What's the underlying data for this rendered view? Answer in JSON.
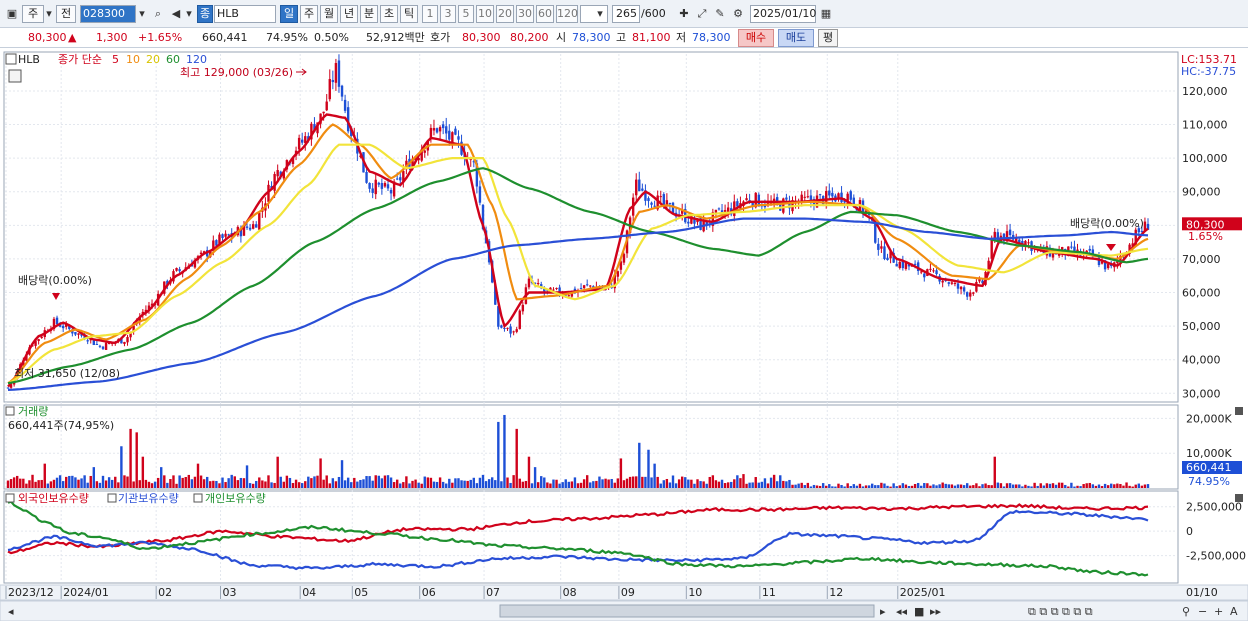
{
  "toolbar": {
    "market": "주",
    "prev": "전",
    "code": "028300",
    "name": "HLB",
    "name_badge": "종",
    "periods": [
      "일",
      "주",
      "월",
      "년",
      "분",
      "초",
      "틱"
    ],
    "selected_period": "일",
    "intervals": [
      "1",
      "3",
      "5",
      "10",
      "20",
      "30",
      "60",
      "120"
    ],
    "count": "265",
    "count_max": "/600",
    "date": "2025/01/10"
  },
  "quote": {
    "price": "80,300",
    "change": "1,300",
    "change_pct": "+1.65%",
    "volume": "660,441",
    "vol_ratio": "74.95%",
    "turnover": "0.50%",
    "amount": "52,912백만",
    "hoga_label": "호가",
    "ask": "80,300",
    "bid": "80,200",
    "open_label": "시",
    "open": "78,300",
    "high_label": "고",
    "high": "81,100",
    "low_label": "저",
    "low": "78,300",
    "buy": "매수",
    "sell": "매도",
    "avg": "평"
  },
  "price_panel": {
    "symbol": "HLB",
    "legend_title": "종가 단순",
    "ma": [
      {
        "period": "5",
        "color": "#d0021b"
      },
      {
        "period": "10",
        "color": "#f08c10"
      },
      {
        "period": "20",
        "color": "#f2e43a"
      },
      {
        "period": "60",
        "color": "#1e8f2e"
      },
      {
        "period": "120",
        "color": "#2a4fd6"
      }
    ],
    "high_annotation": "최고 129,000 (03/26)",
    "low_annotation": "최저 31,650 (12/08)",
    "dividend_left": "배당락(0.00%)",
    "dividend_right": "배당락(0.00%)",
    "lc": "LC:153.71",
    "hc": "HC:-37.75",
    "current_price": "80,300",
    "current_pct": "1.65%",
    "y_ticks": [
      120000,
      110000,
      100000,
      90000,
      80000,
      70000,
      60000,
      50000,
      40000,
      30000
    ],
    "y_tick_labels": [
      "120,000",
      "110,000",
      "100,000",
      "90,000",
      "80,000",
      "70,000",
      "60,000",
      "50,000",
      "40,000",
      "30,000"
    ]
  },
  "volume_panel": {
    "title": "거래량",
    "value": "660,441주(74,95%)",
    "tick_labels": [
      "20,000K",
      "10,000K"
    ],
    "tick_values": [
      20000,
      10000
    ],
    "current": "660,441",
    "current_pct": "74.95%"
  },
  "holdings_panel": {
    "legend": [
      "외국인보유수량",
      "기관보유수량",
      "개인보유수량"
    ],
    "colors": [
      "#d0021b",
      "#2a4fd6",
      "#1e8f2e"
    ],
    "tick_labels": [
      "2,500,000",
      "0",
      "-2,500,000"
    ]
  },
  "x_axis": {
    "labels": [
      "2023/12",
      "2024/01",
      "02",
      "03",
      "04",
      "05",
      "06",
      "07",
      "08",
      "09",
      "10",
      "11",
      "12",
      "2025/01"
    ],
    "right_label": "01/10"
  },
  "chart_data": {
    "type": "candlestick",
    "x_range": [
      "2023/12",
      "2025/01/10"
    ],
    "ylim": [
      28000,
      131000
    ],
    "close_anchors": [
      [
        0,
        31650
      ],
      [
        8,
        45000
      ],
      [
        15,
        51000
      ],
      [
        25,
        47000
      ],
      [
        30,
        44000
      ],
      [
        38,
        46000
      ],
      [
        45,
        55000
      ],
      [
        55,
        66000
      ],
      [
        62,
        70000
      ],
      [
        70,
        76000
      ],
      [
        80,
        80000
      ],
      [
        88,
        96000
      ],
      [
        95,
        104000
      ],
      [
        102,
        112000
      ],
      [
        107,
        126000
      ],
      [
        112,
        108000
      ],
      [
        118,
        92000
      ],
      [
        125,
        90000
      ],
      [
        132,
        100000
      ],
      [
        140,
        109000
      ],
      [
        147,
        104000
      ],
      [
        152,
        98000
      ],
      [
        156,
        75000
      ],
      [
        160,
        50000
      ],
      [
        165,
        48000
      ],
      [
        170,
        63000
      ],
      [
        176,
        60000
      ],
      [
        183,
        60000
      ],
      [
        190,
        62000
      ],
      [
        196,
        61000
      ],
      [
        200,
        68000
      ],
      [
        205,
        92000
      ],
      [
        210,
        88000
      ],
      [
        218,
        84000
      ],
      [
        226,
        80000
      ],
      [
        234,
        84000
      ],
      [
        242,
        88000
      ],
      [
        250,
        86000
      ],
      [
        258,
        87000
      ],
      [
        266,
        88000
      ],
      [
        274,
        89000
      ],
      [
        280,
        84000
      ],
      [
        285,
        72000
      ],
      [
        293,
        68000
      ],
      [
        303,
        65000
      ],
      [
        313,
        60000
      ],
      [
        318,
        63000
      ],
      [
        322,
        77000
      ],
      [
        330,
        76000
      ],
      [
        338,
        72000
      ],
      [
        346,
        72000
      ],
      [
        353,
        71000
      ],
      [
        360,
        67000
      ],
      [
        364,
        72000
      ],
      [
        369,
        78000
      ],
      [
        372,
        80300
      ]
    ],
    "ma_anchors": {
      "5": [
        [
          0,
          32000
        ],
        [
          10,
          47000
        ],
        [
          18,
          51000
        ],
        [
          28,
          46000
        ],
        [
          35,
          45000
        ],
        [
          45,
          54000
        ],
        [
          55,
          65000
        ],
        [
          65,
          72000
        ],
        [
          75,
          78000
        ],
        [
          85,
          90000
        ],
        [
          95,
          102000
        ],
        [
          104,
          113000
        ],
        [
          110,
          112000
        ],
        [
          118,
          96000
        ],
        [
          128,
          92000
        ],
        [
          138,
          106000
        ],
        [
          148,
          104000
        ],
        [
          155,
          80000
        ],
        [
          162,
          50000
        ],
        [
          170,
          60000
        ],
        [
          180,
          60000
        ],
        [
          195,
          61000
        ],
        [
          203,
          85000
        ],
        [
          208,
          90000
        ],
        [
          218,
          83000
        ],
        [
          230,
          81000
        ],
        [
          242,
          87000
        ],
        [
          258,
          87000
        ],
        [
          272,
          88000
        ],
        [
          282,
          82000
        ],
        [
          290,
          70000
        ],
        [
          305,
          64000
        ],
        [
          318,
          62000
        ],
        [
          324,
          76000
        ],
        [
          340,
          72000
        ],
        [
          355,
          70000
        ],
        [
          362,
          68000
        ],
        [
          372,
          79000
        ]
      ],
      "10": [
        [
          0,
          33000
        ],
        [
          12,
          45000
        ],
        [
          22,
          49000
        ],
        [
          32,
          46000
        ],
        [
          45,
          52000
        ],
        [
          58,
          64000
        ],
        [
          70,
          74000
        ],
        [
          82,
          84000
        ],
        [
          95,
          98000
        ],
        [
          106,
          110000
        ],
        [
          115,
          104000
        ],
        [
          125,
          94000
        ],
        [
          138,
          104000
        ],
        [
          150,
          104000
        ],
        [
          158,
          86000
        ],
        [
          166,
          58000
        ],
        [
          178,
          59000
        ],
        [
          196,
          62000
        ],
        [
          206,
          84000
        ],
        [
          215,
          86000
        ],
        [
          228,
          82000
        ],
        [
          245,
          86000
        ],
        [
          262,
          87000
        ],
        [
          278,
          86000
        ],
        [
          290,
          76000
        ],
        [
          308,
          65000
        ],
        [
          320,
          64000
        ],
        [
          330,
          74000
        ],
        [
          346,
          72000
        ],
        [
          362,
          70000
        ],
        [
          372,
          76000
        ]
      ],
      "20": [
        [
          0,
          33000
        ],
        [
          15,
          43000
        ],
        [
          28,
          47000
        ],
        [
          40,
          48000
        ],
        [
          55,
          59000
        ],
        [
          70,
          69000
        ],
        [
          85,
          80000
        ],
        [
          98,
          92000
        ],
        [
          108,
          104000
        ],
        [
          118,
          104000
        ],
        [
          130,
          97000
        ],
        [
          145,
          100000
        ],
        [
          155,
          100000
        ],
        [
          163,
          82000
        ],
        [
          172,
          62000
        ],
        [
          185,
          58000
        ],
        [
          198,
          62000
        ],
        [
          210,
          79000
        ],
        [
          222,
          83000
        ],
        [
          240,
          84000
        ],
        [
          260,
          86000
        ],
        [
          278,
          86000
        ],
        [
          292,
          79000
        ],
        [
          310,
          68000
        ],
        [
          325,
          66000
        ],
        [
          340,
          72000
        ],
        [
          360,
          71000
        ],
        [
          372,
          73000
        ]
      ],
      "60": [
        [
          0,
          33000
        ],
        [
          20,
          38000
        ],
        [
          40,
          43000
        ],
        [
          60,
          51000
        ],
        [
          80,
          62000
        ],
        [
          100,
          75000
        ],
        [
          120,
          85000
        ],
        [
          140,
          93000
        ],
        [
          155,
          97000
        ],
        [
          170,
          91000
        ],
        [
          190,
          84000
        ],
        [
          210,
          78000
        ],
        [
          230,
          73000
        ],
        [
          245,
          71000
        ],
        [
          260,
          78000
        ],
        [
          275,
          84000
        ],
        [
          290,
          83000
        ],
        [
          310,
          78000
        ],
        [
          330,
          74000
        ],
        [
          350,
          72000
        ],
        [
          365,
          69000
        ],
        [
          372,
          70000
        ]
      ],
      "120": [
        [
          0,
          31000
        ],
        [
          30,
          33500
        ],
        [
          60,
          39000
        ],
        [
          90,
          48000
        ],
        [
          120,
          59000
        ],
        [
          145,
          70000
        ],
        [
          165,
          74000
        ],
        [
          190,
          76000
        ],
        [
          215,
          78000
        ],
        [
          240,
          82000
        ],
        [
          260,
          82000
        ],
        [
          280,
          81000
        ],
        [
          300,
          78000
        ],
        [
          320,
          76000
        ],
        [
          345,
          77000
        ],
        [
          360,
          78000
        ],
        [
          372,
          77000
        ]
      ]
    },
    "volume_note": "daily volume bars in thousands of shares; peak ~21,000K near 2024/05 end",
    "holdings_anchors": {
      "foreign": [
        [
          0,
          -2200000
        ],
        [
          15,
          -1200000
        ],
        [
          30,
          -1600000
        ],
        [
          50,
          -1000000
        ],
        [
          70,
          0
        ],
        [
          90,
          -600000
        ],
        [
          110,
          -1000000
        ],
        [
          130,
          200000
        ],
        [
          150,
          200000
        ],
        [
          170,
          1000000
        ],
        [
          190,
          1300000
        ],
        [
          210,
          1700000
        ],
        [
          230,
          2200000
        ],
        [
          250,
          2200000
        ],
        [
          270,
          2400000
        ],
        [
          290,
          2300000
        ],
        [
          310,
          2500000
        ],
        [
          330,
          2600000
        ],
        [
          350,
          2300000
        ],
        [
          372,
          2400000
        ]
      ],
      "institution": [
        [
          0,
          -1800000
        ],
        [
          15,
          -600000
        ],
        [
          30,
          -1500000
        ],
        [
          45,
          -1200000
        ],
        [
          60,
          -1800000
        ],
        [
          80,
          -3500000
        ],
        [
          100,
          -3800000
        ],
        [
          120,
          -3400000
        ],
        [
          140,
          -3600000
        ],
        [
          160,
          -2800000
        ],
        [
          180,
          -2600000
        ],
        [
          200,
          -2900000
        ],
        [
          220,
          -3000000
        ],
        [
          240,
          -2800000
        ],
        [
          255,
          -300000
        ],
        [
          270,
          -500000
        ],
        [
          285,
          -800000
        ],
        [
          300,
          -1200000
        ],
        [
          315,
          -1000000
        ],
        [
          328,
          2000000
        ],
        [
          345,
          1800000
        ],
        [
          360,
          1500000
        ],
        [
          372,
          1200000
        ]
      ],
      "individual": [
        [
          0,
          3000000
        ],
        [
          12,
          1000000
        ],
        [
          20,
          -200000
        ],
        [
          30,
          -600000
        ],
        [
          45,
          -1800000
        ],
        [
          60,
          -1200000
        ],
        [
          80,
          -300000
        ],
        [
          100,
          400000
        ],
        [
          120,
          -200000
        ],
        [
          140,
          -800000
        ],
        [
          160,
          -1500000
        ],
        [
          180,
          -1800000
        ],
        [
          200,
          -2200000
        ],
        [
          220,
          -3400000
        ],
        [
          240,
          -3600000
        ],
        [
          260,
          -3200000
        ],
        [
          280,
          -2800000
        ],
        [
          300,
          -3200000
        ],
        [
          320,
          -3400000
        ],
        [
          340,
          -3600000
        ],
        [
          355,
          -4200000
        ],
        [
          372,
          -4400000
        ]
      ]
    }
  }
}
